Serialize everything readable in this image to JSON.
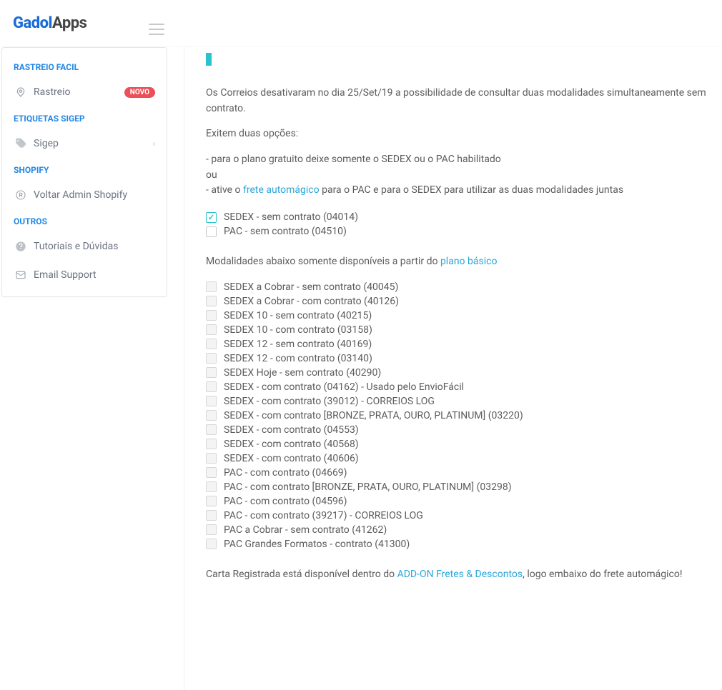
{
  "header": {
    "logo_part_color": "Gadol",
    "logo_part_dark": "Apps"
  },
  "sidebar": {
    "sections": [
      {
        "title": "RASTREIO FACIL",
        "items": [
          {
            "label": "Rastreio",
            "icon": "pin-icon",
            "badge": "NOVO"
          }
        ]
      },
      {
        "title": "ETIQUETAS SIGEP",
        "items": [
          {
            "label": "Sigep",
            "icon": "tag-icon",
            "chevron": true
          }
        ]
      },
      {
        "title": "SHOPIFY",
        "items": [
          {
            "label": "Voltar Admin Shopify",
            "icon": "registered-icon"
          }
        ]
      },
      {
        "title": "OUTROS",
        "items": [
          {
            "label": "Tutoriais e Dúvidas",
            "icon": "help-icon"
          },
          {
            "label": "Email Support",
            "icon": "mail-icon"
          }
        ]
      }
    ]
  },
  "main": {
    "para1": "Os Correios desativaram no dia 25/Set/19 a possibilidade de consultar duas modalidades simultaneamente sem contrato.",
    "para2": "Exitem duas opções:",
    "para3a": "- para o plano gratuito deixe somente o SEDEX ou o PAC habilitado",
    "para3b": "ou",
    "para3c_pre": "- ative o ",
    "para3c_link": "frete automágico",
    "para3c_post": " para o PAC e para o SEDEX para utilizar as duas modalidades juntas",
    "free_options": [
      {
        "label": "SEDEX - sem contrato (04014)",
        "checked": true
      },
      {
        "label": "PAC - sem contrato (04510)",
        "checked": false
      }
    ],
    "basic_notice_pre": "Modalidades abaixo somente disponíveis a partir do ",
    "basic_notice_link": "plano básico",
    "basic_options": [
      {
        "label": "SEDEX a Cobrar - sem contrato (40045)"
      },
      {
        "label": "SEDEX a Cobrar - com contrato (40126)"
      },
      {
        "label": "SEDEX 10 - sem contrato (40215)"
      },
      {
        "label": "SEDEX 10 - com contrato (03158)"
      },
      {
        "label": "SEDEX 12 - sem contrato (40169)"
      },
      {
        "label": "SEDEX 12 - com contrato (03140)"
      },
      {
        "label": "SEDEX Hoje - sem contrato (40290)"
      },
      {
        "label": "SEDEX - com contrato (04162) - Usado pelo EnvioFácil"
      },
      {
        "label": "SEDEX - com contrato (39012) - CORREIOS LOG"
      },
      {
        "label": "SEDEX - com contrato [BRONZE, PRATA, OURO, PLATINUM] (03220)"
      },
      {
        "label": "SEDEX - com contrato (04553)"
      },
      {
        "label": "SEDEX - com contrato (40568)"
      },
      {
        "label": "SEDEX - com contrato (40606)"
      },
      {
        "label": "PAC - com contrato (04669)"
      },
      {
        "label": "PAC - com contrato [BRONZE, PRATA, OURO, PLATINUM] (03298)"
      },
      {
        "label": "PAC - com contrato (04596)"
      },
      {
        "label": "PAC - com contrato (39217) - CORREIOS LOG"
      },
      {
        "label": "PAC a Cobrar - sem contrato (41262)"
      },
      {
        "label": "PAC Grandes Formatos - contrato (41300)"
      }
    ],
    "carta_pre": "Carta Registrada está disponível dentro do ",
    "carta_link": "ADD-ON Fretes & Descontos",
    "carta_post": ", logo embaixo do frete automágico!"
  }
}
